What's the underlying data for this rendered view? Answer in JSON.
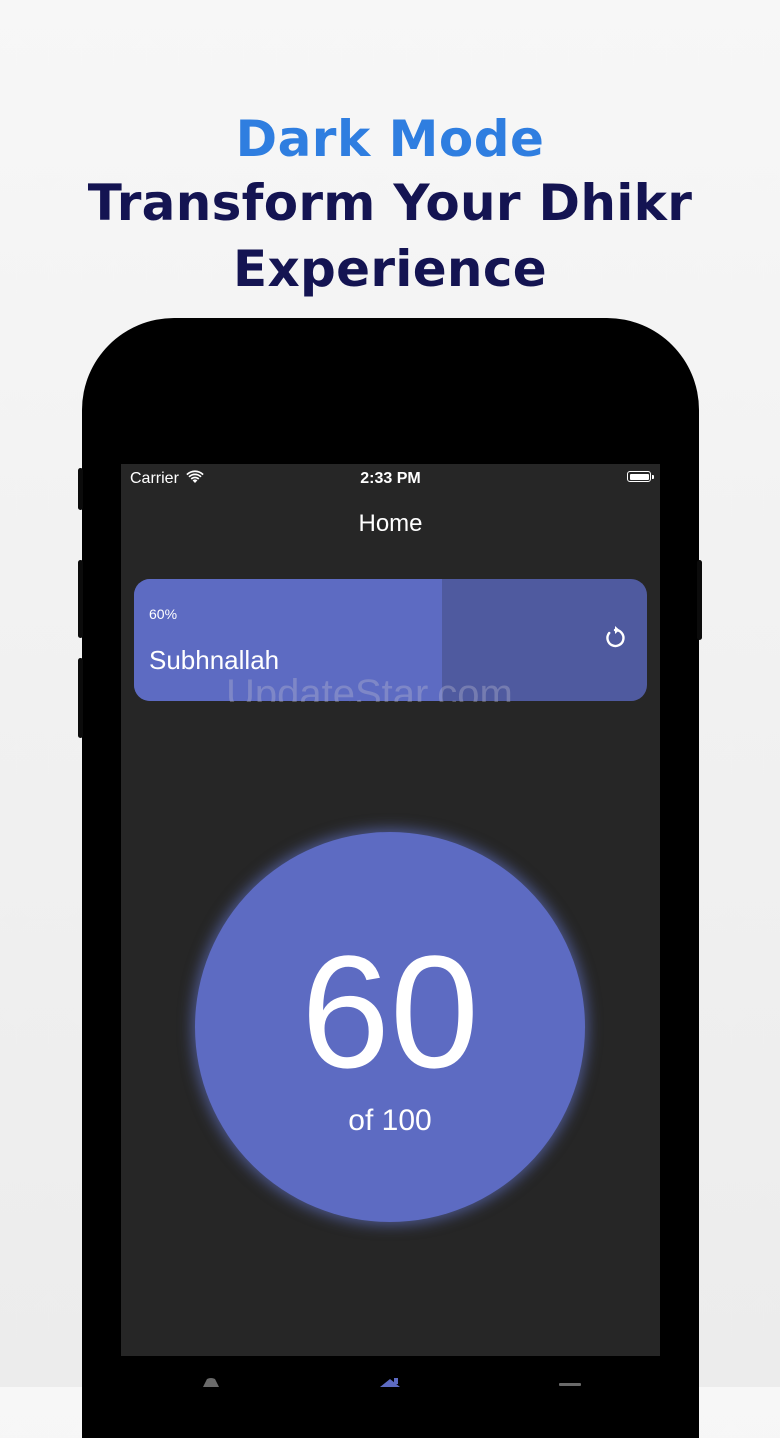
{
  "promo": {
    "accent_title": "Dark Mode",
    "main_title_line1": "Transform Your Dhikr",
    "main_title_line2": "Experience"
  },
  "status_bar": {
    "carrier": "Carrier",
    "time": "2:33 PM",
    "icons": [
      "wifi-icon",
      "battery-icon"
    ]
  },
  "nav": {
    "title": "Home"
  },
  "dhikr_card": {
    "percent_label": "60%",
    "progress_fraction": 0.6,
    "name": "Subhnallah",
    "reset_icon": "reset-icon"
  },
  "counter": {
    "value": "60",
    "target_label": "of 100"
  },
  "watermark": "UpdateStar.com",
  "tab_bar": {
    "icons": [
      "tab-icon-left",
      "home-icon",
      "tab-icon-right"
    ]
  },
  "colors": {
    "accent": "#2f7ee0",
    "title_navy": "#141452",
    "screen_bg": "#262626",
    "primary_indigo": "#5d6bc2",
    "card_track": "#4f5a9f"
  }
}
